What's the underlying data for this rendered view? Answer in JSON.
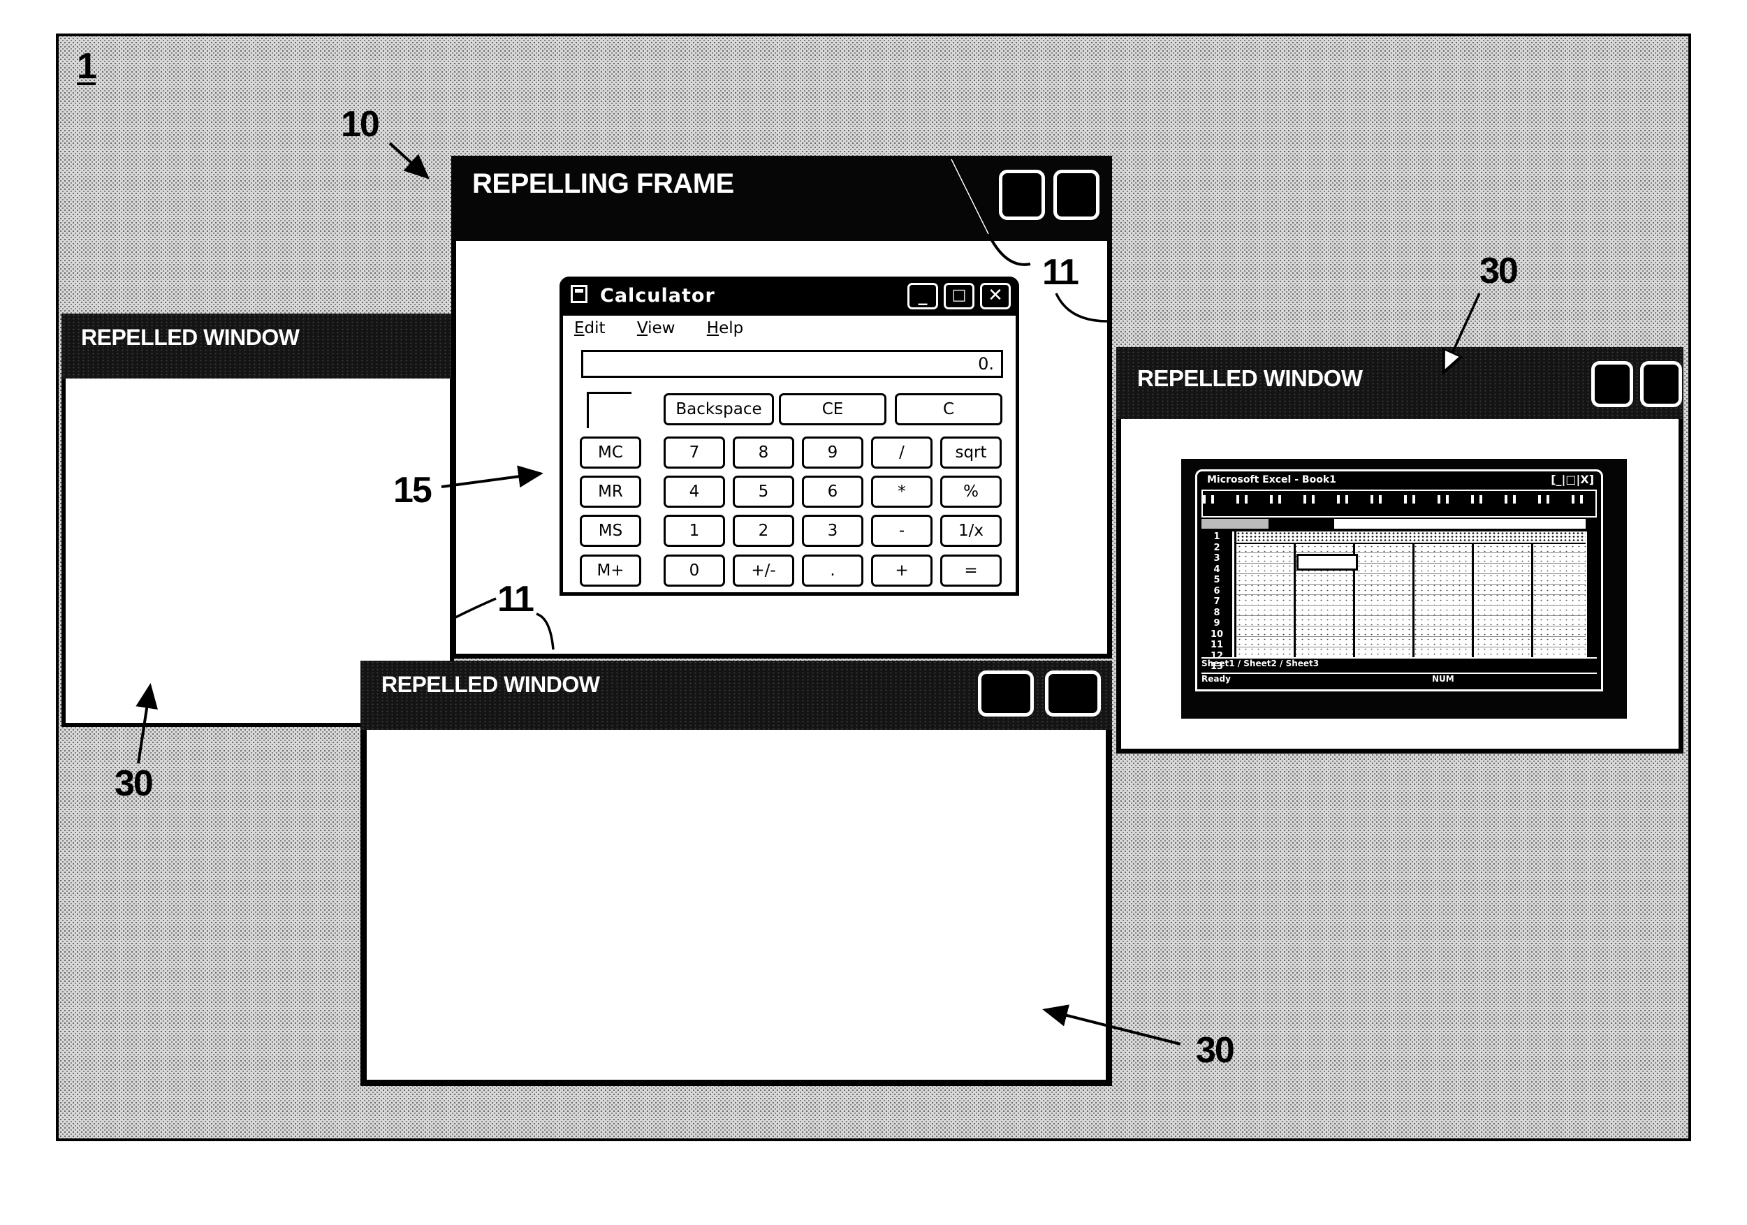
{
  "figure": {
    "ref_numeral": "1"
  },
  "repelling_frame": {
    "title": "REPELLING FRAME",
    "ref_numeral": "10",
    "edge_ref_numeral": "11",
    "title_buttons": [
      "button-1",
      "button-2"
    ]
  },
  "calculator": {
    "ref_numeral": "15",
    "title": "Calculator",
    "controls": {
      "minimize": "_",
      "maximize": "□",
      "close": "✕"
    },
    "menu": [
      {
        "label": "Edit",
        "mnemonic": "E"
      },
      {
        "label": "View",
        "mnemonic": "V"
      },
      {
        "label": "Help",
        "mnemonic": "H"
      }
    ],
    "display": "0.",
    "top_row": [
      "Backspace",
      "CE",
      "C"
    ],
    "memory_keys": [
      "MC",
      "MR",
      "MS",
      "M+"
    ],
    "keypad": [
      [
        "7",
        "8",
        "9",
        "/",
        "sqrt"
      ],
      [
        "4",
        "5",
        "6",
        "*",
        "%"
      ],
      [
        "1",
        "2",
        "3",
        "-",
        "1/x"
      ],
      [
        "0",
        "+/-",
        ".",
        "+",
        "="
      ]
    ]
  },
  "repelled_windows": [
    {
      "id": "left",
      "title": "REPELLED WINDOW",
      "ref_numeral": "30"
    },
    {
      "id": "right",
      "title": "REPELLED WINDOW",
      "ref_numeral": "30"
    },
    {
      "id": "bottom",
      "title": "REPELLED WINDOW",
      "ref_numeral": "30"
    }
  ],
  "excel": {
    "title": "Microsoft Excel - Book1",
    "controls": "[_|□|X]",
    "row_headers": [
      "1",
      "2",
      "3",
      "4",
      "5",
      "6",
      "7",
      "8",
      "9",
      "10",
      "11",
      "12",
      "13"
    ],
    "sheet_tabs": "Sheet1 / Sheet2 / Sheet3",
    "status": "Ready",
    "status_right": "NUM"
  },
  "bottom_edge_ref_numeral": "11"
}
